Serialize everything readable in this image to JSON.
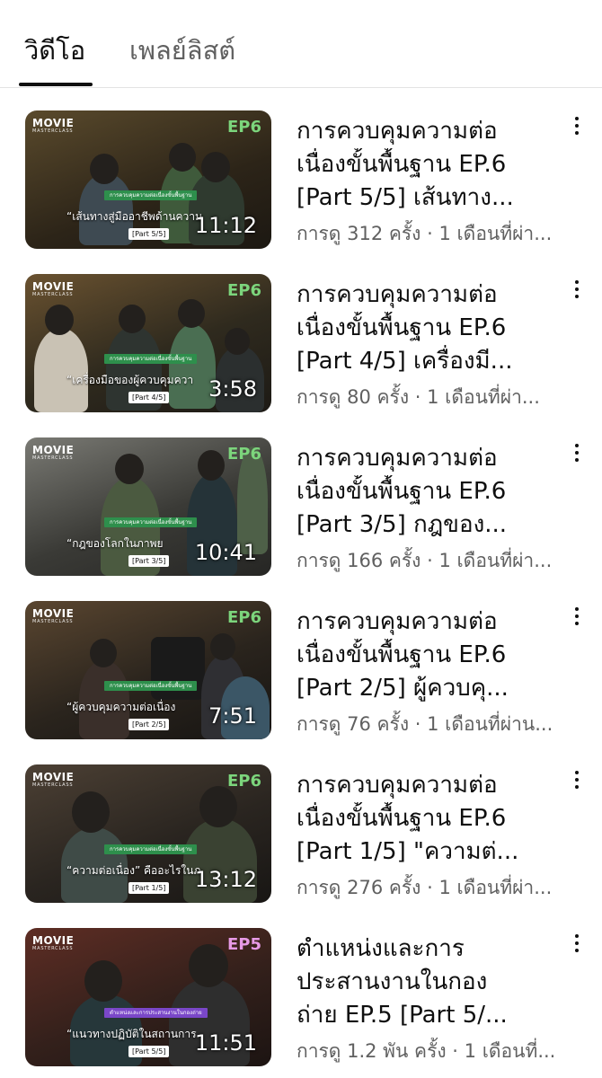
{
  "tabs": [
    {
      "label": "วิดีโอ",
      "active": true
    },
    {
      "label": "เพลย์ลิสต์",
      "active": false
    }
  ],
  "colors": {
    "ep_green": "#7CD57C",
    "ep_pink": "#E79AE6",
    "strip_green": "#2E8F4C",
    "strip_purple": "#7A47C8"
  },
  "videos": [
    {
      "title_lines": [
        "การควบคุมความต่อ",
        "เนื่องขั้นพื้นฐาน EP.6",
        "[Part 5/5] เส้นทาง..."
      ],
      "meta": "การดู 312 ครั้ง · 1 เดือนที่ผ่า...",
      "duration": "11:12",
      "thumb": {
        "logo": "MOVIE",
        "logo_sub": "MASTERCLASS",
        "ep": "EP6",
        "strip": "การควบคุมความต่อเนื่องขั้นพื้นฐาน",
        "quote": "“เส้นทางสู่มืออาชีพด้านความ",
        "part": "[Part 5/5]"
      }
    },
    {
      "title_lines": [
        "การควบคุมความต่อ",
        "เนื่องขั้นพื้นฐาน EP.6",
        "[Part 4/5] เครื่องมี..."
      ],
      "meta": "การดู 80 ครั้ง · 1 เดือนที่ผ่า...",
      "duration": "3:58",
      "thumb": {
        "logo": "MOVIE",
        "logo_sub": "MASTERCLASS",
        "ep": "EP6",
        "strip": "การควบคุมความต่อเนื่องขั้นพื้นฐาน",
        "quote": "“เครื่องมือของผู้ควบคุมควา",
        "part": "[Part 4/5]"
      }
    },
    {
      "title_lines": [
        "การควบคุมความต่อ",
        "เนื่องขั้นพื้นฐาน EP.6",
        "[Part 3/5] กฎของ..."
      ],
      "meta": "การดู 166 ครั้ง · 1 เดือนที่ผ่า...",
      "duration": "10:41",
      "thumb": {
        "logo": "MOVIE",
        "logo_sub": "MASTERCLASS",
        "ep": "EP6",
        "strip": "การควบคุมความต่อเนื่องขั้นพื้นฐาน",
        "quote": "“กฎของโลกในภาพย",
        "part": "[Part 3/5]"
      }
    },
    {
      "title_lines": [
        "การควบคุมความต่อ",
        "เนื่องขั้นพื้นฐาน EP.6",
        "[Part 2/5] ผู้ควบคุ..."
      ],
      "meta": "การดู 76 ครั้ง · 1 เดือนที่ผ่าน...",
      "duration": "7:51",
      "thumb": {
        "logo": "MOVIE",
        "logo_sub": "MASTERCLASS",
        "ep": "EP6",
        "strip": "การควบคุมความต่อเนื่องขั้นพื้นฐาน",
        "quote": "“ผู้ควบคุมความต่อเนื่อง",
        "part": "[Part 2/5]"
      }
    },
    {
      "title_lines": [
        "การควบคุมความต่อ",
        "เนื่องขั้นพื้นฐาน EP.6",
        "[Part 1/5] \"ความต่..."
      ],
      "meta": "การดู 276 ครั้ง · 1 เดือนที่ผ่า...",
      "duration": "13:12",
      "thumb": {
        "logo": "MOVIE",
        "logo_sub": "MASTERCLASS",
        "ep": "EP6",
        "strip": "การควบคุมความต่อเนื่องขั้นพื้นฐาน",
        "quote": "“ความต่อเนื่อง” คืออะไรในภ",
        "part": "[Part 1/5]"
      }
    },
    {
      "title_lines": [
        "ตำแหน่งและการ",
        "ประสานงานในกอง",
        "ถ่าย EP.5 [Part 5/..."
      ],
      "meta": "การดู 1.2 พัน ครั้ง · 1 เดือนที่...",
      "duration": "11:51",
      "thumb": {
        "logo": "MOVIE",
        "logo_sub": "MASTERCLASS",
        "ep": "EP5",
        "strip": "ตำแหน่งและการประสานงานในกองถ่าย",
        "quote": "“แนวทางปฏิบัติในสถานการ",
        "part": "[Part 5/5]"
      }
    }
  ]
}
